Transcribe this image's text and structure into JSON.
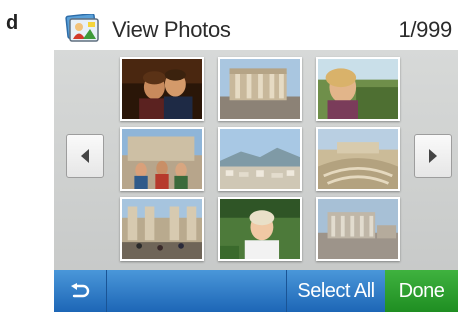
{
  "figure": {
    "label": "d"
  },
  "header": {
    "icon": "photos-app-icon",
    "title": "View Photos",
    "counter": "1/999"
  },
  "navigation": {
    "prev_icon": "triangle-left-icon",
    "next_icon": "triangle-right-icon"
  },
  "photos": [
    {
      "name": "photo-couple-night",
      "selected": false
    },
    {
      "name": "photo-ruins-columns",
      "selected": false
    },
    {
      "name": "photo-woman-outdoors",
      "selected": false
    },
    {
      "name": "photo-group-tourists",
      "selected": false
    },
    {
      "name": "photo-city-hill",
      "selected": false
    },
    {
      "name": "photo-amphitheater",
      "selected": false
    },
    {
      "name": "photo-street-crowd",
      "selected": false
    },
    {
      "name": "photo-woman-garden",
      "selected": false
    },
    {
      "name": "photo-ancient-site",
      "selected": false
    }
  ],
  "toolbar": {
    "back_icon": "back-arrow-icon",
    "select_all_label": "Select All",
    "done_label": "Done"
  },
  "colors": {
    "toolbar_blue": "#2c78c6",
    "done_green": "#2a9e2d",
    "stage_gray": "#d0d2d1"
  }
}
